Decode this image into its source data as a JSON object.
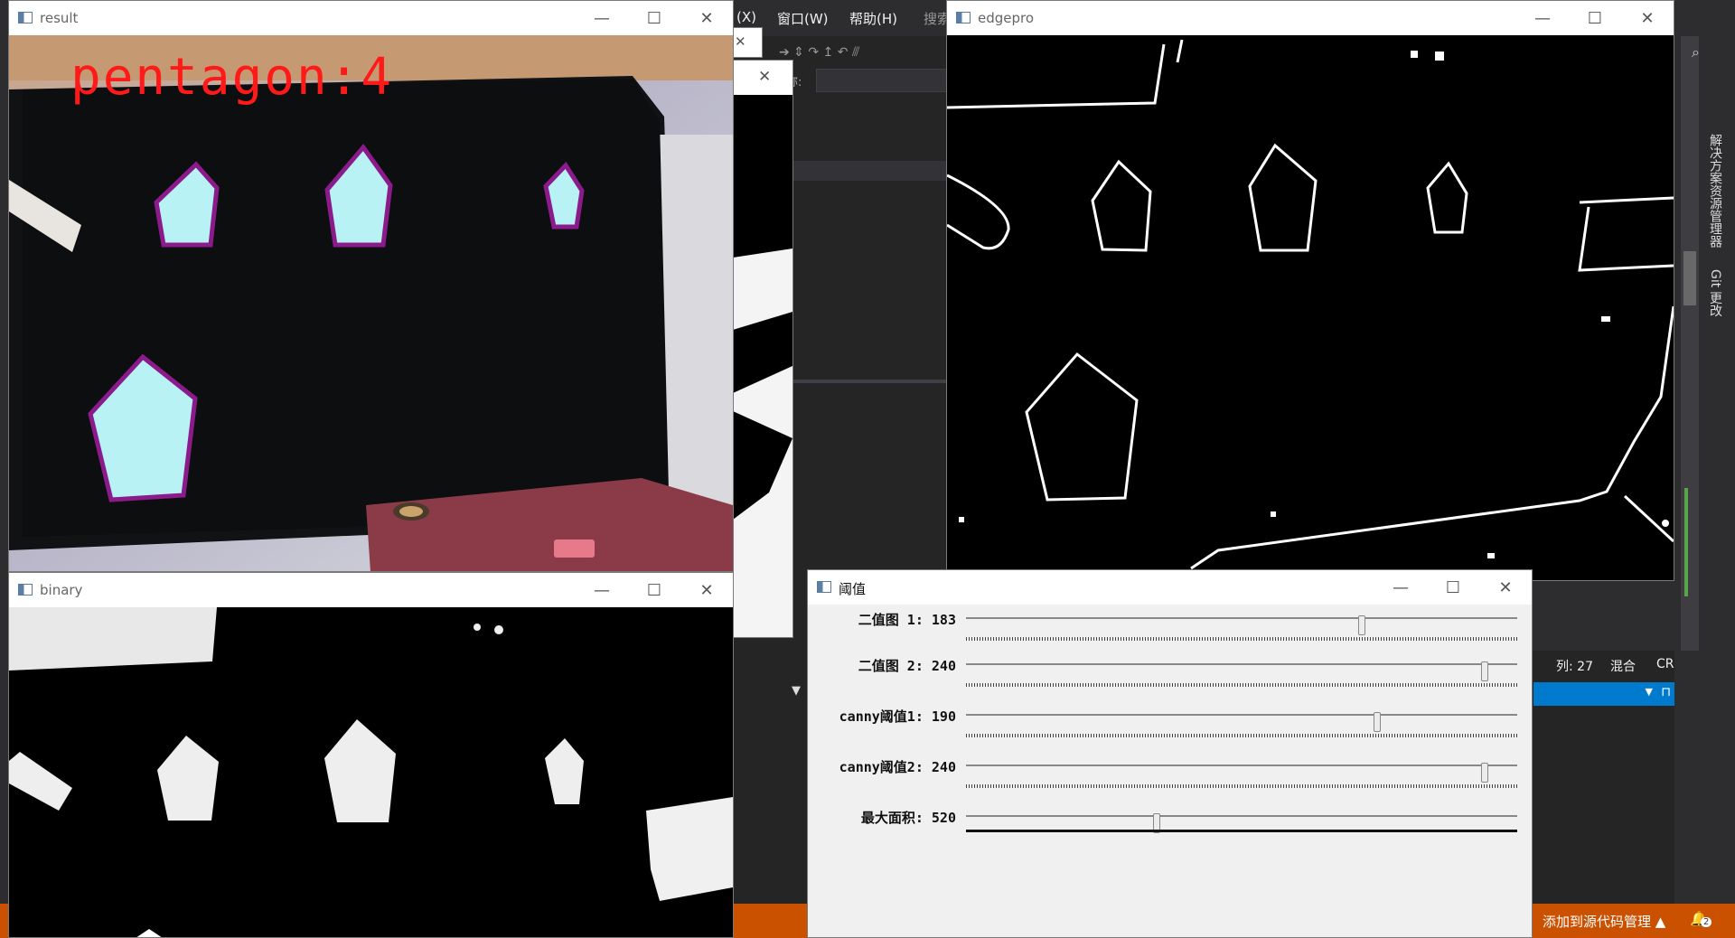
{
  "ide": {
    "menu": [
      "(X)",
      "窗口(W)",
      "帮助(H)",
      "搜索"
    ],
    "partial_label": "称:",
    "status": {
      "col": "列: 27",
      "mode": "混合",
      "eol": "CRLF"
    },
    "source_control": "添加到源代码管理 ▲",
    "notification_count": "2",
    "side_tabs": [
      "解决方案资源管理器",
      "Git 更改"
    ]
  },
  "windows": {
    "result": {
      "title": "result",
      "overlay_text": "pentagon:4"
    },
    "binary": {
      "title": "binary"
    },
    "edgepro": {
      "title": "edgepro"
    },
    "threshold": {
      "title": "阈值",
      "sliders": [
        {
          "label": "二值图 1: 183",
          "value": 183,
          "max": 255
        },
        {
          "label": "二值图 2: 240",
          "value": 240,
          "max": 255
        },
        {
          "label": "canny阈值1: 190",
          "value": 190,
          "max": 255
        },
        {
          "label": "canny阈值2: 240",
          "value": 240,
          "max": 255
        },
        {
          "label": "最大面积: 520",
          "value": 520,
          "max": 1500
        }
      ]
    }
  },
  "colors": {
    "accent": "#ca5100",
    "pentagon_fill": "#b8f2f5",
    "pentagon_outline": "#8b1a8b",
    "label_red": "#ff1a1a"
  }
}
